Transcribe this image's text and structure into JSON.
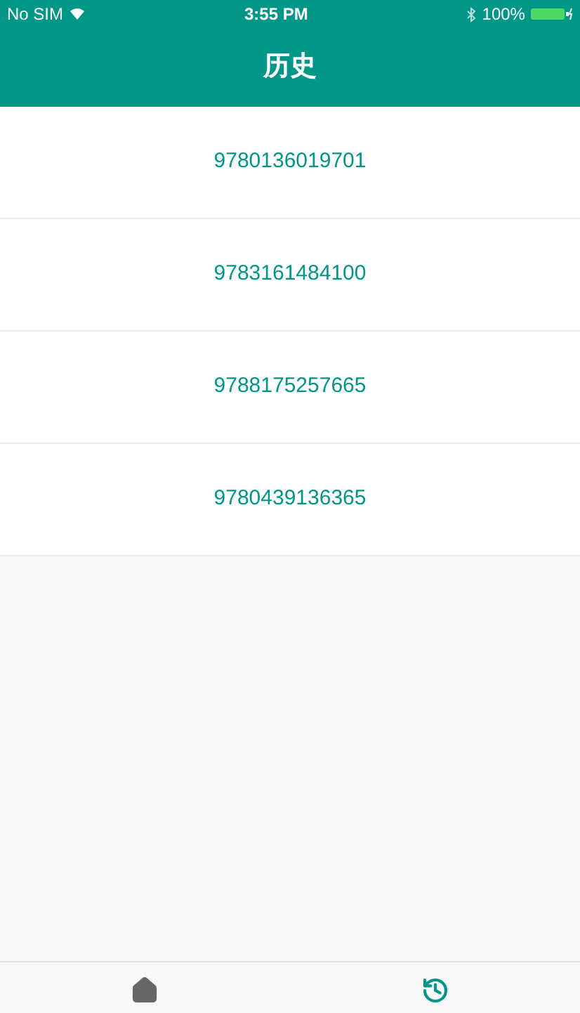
{
  "status_bar": {
    "carrier": "No SIM",
    "time": "3:55 PM",
    "battery": "100%"
  },
  "header": {
    "title": "历史"
  },
  "items": [
    "9780136019701",
    "9783161484100",
    "9788175257665",
    "9780439136365"
  ],
  "tab_bar": [
    {
      "kind": "home",
      "selected": false
    },
    {
      "kind": "history",
      "selected": true
    }
  ]
}
